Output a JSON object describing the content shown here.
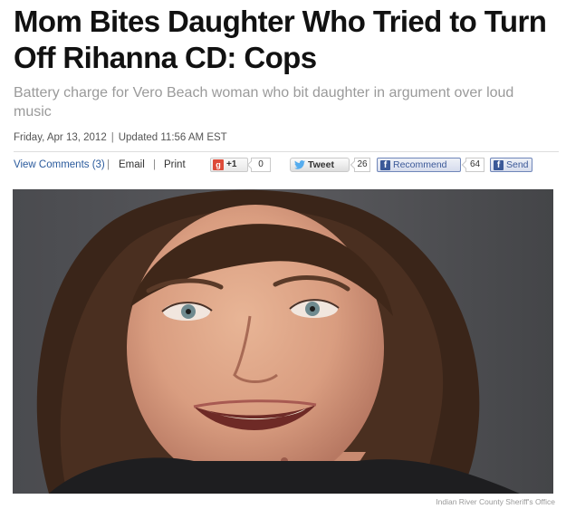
{
  "article": {
    "headline": "Mom Bites Daughter Who Tried to Turn Off Rihanna CD: Cops",
    "subhead": "Battery charge for Vero Beach woman who bit daughter in argument over loud music",
    "date": "Friday, Apr 13, 2012",
    "date_sep": "|",
    "updated": "Updated 11:56 AM EST"
  },
  "sharebar": {
    "view_comments": "View Comments (3)",
    "email": "Email",
    "print": "Print",
    "separator": "|",
    "gplus_letter": "g",
    "gplus_label": "+1",
    "gplus_count": "0",
    "tweet_label": "Tweet",
    "tweet_count": "26",
    "fb_letter": "f",
    "fb_recommend_label": "Recommend",
    "fb_recommend_count": "64",
    "fb_send_label": "Send"
  },
  "photo": {
    "subject_icon": "woman-portrait-photo",
    "credit": "Indian River County Sheriff's Office"
  },
  "colors": {
    "link": "#2a5a9c",
    "headline": "#111111",
    "subhead": "#9a9a9a",
    "facebook": "#3b5998",
    "google": "#dd4b39"
  }
}
